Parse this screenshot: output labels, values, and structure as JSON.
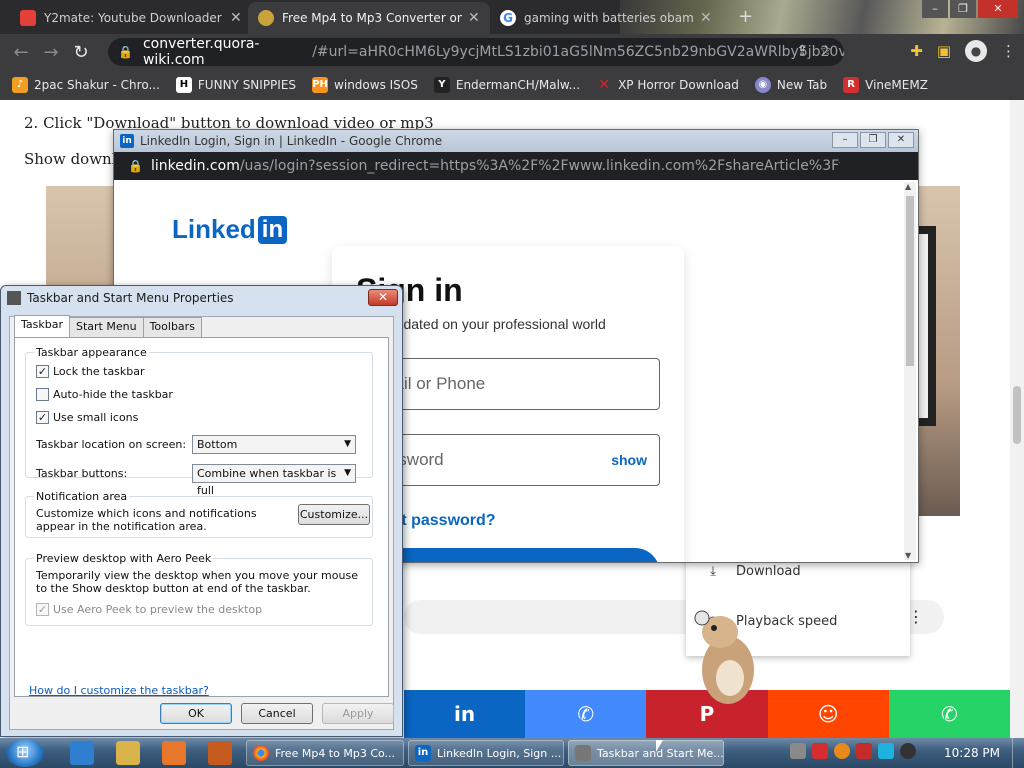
{
  "browser": {
    "tabs": [
      {
        "title": "Y2mate: Youtube Downloader -",
        "active": false,
        "favicon_color": "#e3403a"
      },
      {
        "title": "Free Mp4 to Mp3 Converter onli",
        "active": true,
        "favicon_color": "#c8a23a"
      },
      {
        "title": "gaming with batteries obama ga",
        "active": false,
        "favicon_color": "#4285f4"
      }
    ],
    "address": {
      "host": "converter.quora-wiki.com",
      "path": "/#url=aHR0cHM6Ly9ycjMtLS1zbi01aG5lNm56ZC5nb29nbGV2aWRlby5jb20vdmlk..."
    },
    "bookmarks": [
      {
        "label": "2pac Shakur - Chro...",
        "icon": "music-icon",
        "color": "#f0a020"
      },
      {
        "label": "FUNNY SNIPPIES",
        "icon": "h-icon",
        "color": "#ffffff"
      },
      {
        "label": "windows ISOS",
        "icon": "ph-icon",
        "color": "#f7931e"
      },
      {
        "label": "EndermanCH/Malw...",
        "icon": "yp-icon",
        "color": "#222222"
      },
      {
        "label": "XP Horror Download",
        "icon": "x-icon",
        "color": "#e02020"
      },
      {
        "label": "New Tab",
        "icon": "globe-icon",
        "color": "#8888cc"
      },
      {
        "label": "VineMEMZ",
        "icon": "r-icon",
        "color": "#d62e2e"
      }
    ]
  },
  "page": {
    "step_text": "2. Click \"Download\" button to download video or mp3",
    "show_text": "Show downlo",
    "video_menu": [
      {
        "label": "Download",
        "icon": "download-icon"
      },
      {
        "label": "Playback speed",
        "icon": "speed-icon"
      }
    ],
    "share_buttons": [
      {
        "icon": "linkedin-icon",
        "glyph": "in",
        "color": "#0a66c2"
      },
      {
        "icon": "messenger-icon",
        "glyph": "✆",
        "color": "#448aff"
      },
      {
        "icon": "pinterest-icon",
        "glyph": "P",
        "color": "#c8232c"
      },
      {
        "icon": "reddit-icon",
        "glyph": "☺",
        "color": "#ff4500"
      },
      {
        "icon": "whatsapp-icon",
        "glyph": "✆",
        "color": "#25d366"
      }
    ]
  },
  "linkedin_popup": {
    "window_title": "LinkedIn Login, Sign in | LinkedIn - Google Chrome",
    "address_host": "linkedin.com",
    "address_path": "/uas/login?session_redirect=https%3A%2F%2Fwww.linkedin.com%2FshareArticle%3Ftitle%3DFree%2520M...",
    "logo_text": "Linked",
    "logo_in": "in",
    "heading": "Sign in",
    "subheading": "Stay updated on your professional world",
    "email_placeholder": "Email or Phone",
    "password_placeholder": "Password",
    "show_label": "show",
    "forgot_label": "Forgot password?"
  },
  "dialog": {
    "title": "Taskbar and Start Menu Properties",
    "tabs": [
      "Taskbar",
      "Start Menu",
      "Toolbars"
    ],
    "appearance_label": "Taskbar appearance",
    "lock_label": "Lock the taskbar",
    "lock_checked": true,
    "autohide_label": "Auto-hide the taskbar",
    "autohide_checked": false,
    "small_icons_label": "Use small icons",
    "small_icons_checked": true,
    "location_label": "Taskbar location on screen:",
    "location_value": "Bottom",
    "buttons_label": "Taskbar buttons:",
    "buttons_value": "Combine when taskbar is full",
    "notification_label": "Notification area",
    "notification_text": "Customize which icons and notifications appear in the notification area.",
    "customize_label": "Customize...",
    "aero_label": "Preview desktop with Aero Peek",
    "aero_text": "Temporarily view the desktop when you move your mouse to the Show desktop button at end of the taskbar.",
    "aero_check_label": "Use Aero Peek to preview the desktop",
    "aero_checked": true,
    "help_link": "How do I customize the taskbar?",
    "ok_label": "OK",
    "cancel_label": "Cancel",
    "apply_label": "Apply"
  },
  "taskbar": {
    "buttons": [
      {
        "label": "Free Mp4 to Mp3 Co...",
        "icon": "chrome-icon",
        "active": false
      },
      {
        "label": "LinkedIn Login, Sign ...",
        "icon": "linkedin-icon",
        "active": false
      },
      {
        "label": "Taskbar and Start Me...",
        "icon": "taskbar-props-icon",
        "active": true
      }
    ],
    "clock": "10:28 PM"
  }
}
